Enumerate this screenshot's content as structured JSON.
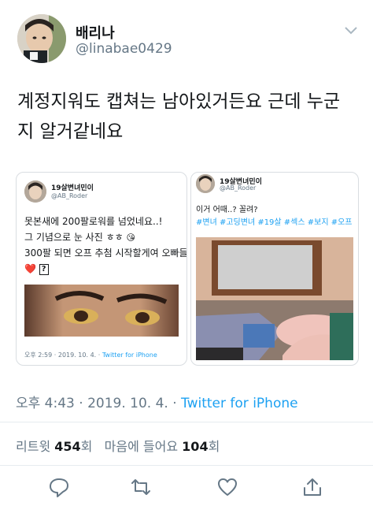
{
  "tweet": {
    "display_name": "배리나",
    "handle": "@linabae0429",
    "text": "계정지워도 캡쳐는 남아있거든요 근데 누군지 알거같네요",
    "time": "오후 4:43",
    "date": "2019. 10. 4.",
    "source": "Twitter for iPhone"
  },
  "stats": {
    "retweets_label": "리트윗",
    "retweets_count": "454",
    "retweets_suffix": "회",
    "likes_label": "마음에 들어요",
    "likes_count": "104",
    "likes_suffix": "회"
  },
  "embedded_left": {
    "name": "19살변녀민이",
    "handle": "@AB_Roder",
    "line1": "못본새에 200팔로워를 넘었네요..!",
    "line2": "그 기념으로 눈 사진 ㅎㅎ",
    "line3": "300팔 되면 오프 추첨 시작할게여 오빠들",
    "line4_emoji": "❤️",
    "line4_box": "?",
    "footer_time": "오후 2:59 · 2019. 10. 4. · ",
    "footer_source": "Twitter for iPhone"
  },
  "embedded_right": {
    "name": "19살변녀민이",
    "handle": "@AB_Roder",
    "line1": "이거 어때..? 꼴려?",
    "hashtags": "#변녀 #고딩변녀 #19살 #섹스 #보지 #오프"
  },
  "icons": [
    "chevron-down-icon",
    "reply-icon",
    "retweet-icon",
    "like-icon",
    "share-icon"
  ],
  "colors": {
    "link": "#1da1f2",
    "muted": "#657786",
    "text": "#14171a"
  }
}
